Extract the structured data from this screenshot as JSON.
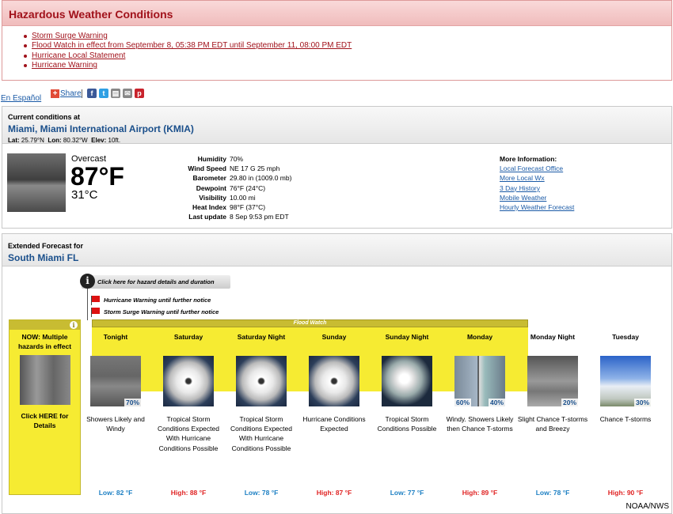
{
  "hazards": {
    "title": "Hazardous Weather Conditions",
    "items": [
      "Storm Surge Warning",
      "Flood Watch in effect from September 8, 05:38 PM EDT until September 11, 08:00 PM EDT",
      "Hurricane Local Statement",
      "Hurricane Warning"
    ]
  },
  "language_link": "En Español",
  "share": {
    "label": "Share",
    "icons": [
      "facebook-icon",
      "twitter-icon",
      "print-icon",
      "email-icon",
      "pinterest-icon"
    ]
  },
  "current": {
    "header": "Current conditions at",
    "station": "Miami, Miami International Airport (KMIA)",
    "lat_label": "Lat:",
    "lat": "25.79°N",
    "lon_label": "Lon:",
    "lon": "80.32°W",
    "elev_label": "Elev:",
    "elev": "10ft.",
    "condition": "Overcast",
    "temp_f": "87°F",
    "temp_c": "31°C",
    "details": [
      {
        "label": "Humidity",
        "value": "70%"
      },
      {
        "label": "Wind Speed",
        "value": "NE 17 G 25 mph"
      },
      {
        "label": "Barometer",
        "value": "29.80 in (1009.0 mb)"
      },
      {
        "label": "Dewpoint",
        "value": "76°F (24°C)"
      },
      {
        "label": "Visibility",
        "value": "10.00 mi"
      },
      {
        "label": "Heat Index",
        "value": "98°F (37°C)"
      },
      {
        "label": "Last update",
        "value": "8 Sep 9:53 pm EDT"
      }
    ],
    "more_info": {
      "title": "More Information:",
      "links": [
        "Local Forecast Office",
        "More Local Wx",
        "3 Day History",
        "Mobile Weather",
        "Hourly Weather Forecast"
      ]
    }
  },
  "extended": {
    "header": "Extended Forecast for",
    "place": "South Miami FL",
    "hazard_button": "Click here for hazard details and duration",
    "warnings": [
      "Hurricane Warning until further notice",
      "Storm Surge Warning until further notice"
    ],
    "flood_watch": "Flood Watch",
    "now": {
      "text": "NOW: Multiple hazards in effect",
      "link": "Click HERE for Details"
    },
    "periods": [
      {
        "name": "Tonight",
        "pop": "70%",
        "desc": "Showers Likely and Windy",
        "temp": "Low: 82 °F",
        "kind": "low"
      },
      {
        "name": "Saturday",
        "pop": "",
        "desc": "Tropical Storm Conditions Expected With Hurricane Conditions Possible",
        "temp": "High: 88 °F",
        "kind": "high"
      },
      {
        "name": "Saturday Night",
        "pop": "",
        "desc": "Tropical Storm Conditions Expected With Hurricane Conditions Possible",
        "temp": "Low: 78 °F",
        "kind": "low"
      },
      {
        "name": "Sunday",
        "pop": "",
        "desc": "Hurricane Conditions Expected",
        "temp": "High: 87 °F",
        "kind": "high"
      },
      {
        "name": "Sunday Night",
        "pop": "",
        "desc": "Tropical Storm Conditions Possible",
        "temp": "Low: 77 °F",
        "kind": "low"
      },
      {
        "name": "Monday",
        "pop_left": "60%",
        "pop": "40%",
        "desc": "Windy. Showers Likely then Chance T-storms",
        "temp": "High: 89 °F",
        "kind": "high"
      },
      {
        "name": "Monday Night",
        "pop": "20%",
        "desc": "Slight Chance T-storms and Breezy",
        "temp": "Low: 78 °F",
        "kind": "low"
      },
      {
        "name": "Tuesday",
        "pop": "30%",
        "desc": "Chance T-storms",
        "temp": "High: 90 °F",
        "kind": "high"
      }
    ]
  },
  "credit": "NOAA/NWS"
}
